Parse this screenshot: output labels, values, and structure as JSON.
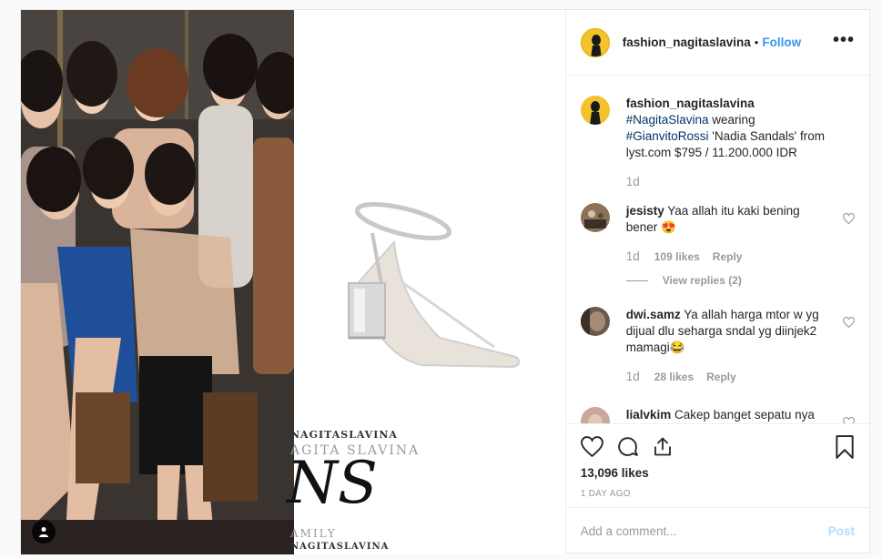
{
  "post": {
    "author": "fashion_nagitaslavina",
    "follow_label": "Follow",
    "separator": "•",
    "more_label": "•••",
    "caption": {
      "username": "fashion_nagitaslavina",
      "hashtag1": "#NagitaSlavina",
      "text1": "wearing",
      "hashtag2": "#GianvitoRossi",
      "text2": "'Nadia Sandals' from lyst.com $795 / 11.200.000 IDR",
      "time": "1d"
    },
    "watermark": {
      "top1": "NAGITASLAVINA",
      "top2": "AGITA SLAVINA",
      "mono": "NS",
      "bottom1": "AMILY",
      "bottom2": "NAGITASLAVINA"
    },
    "comments": [
      {
        "username": "jesisty",
        "text": "Yaa allah itu kaki bening bener 😍",
        "time": "1d",
        "likes": "109 likes",
        "reply": "Reply",
        "view_replies": "View replies (2)"
      },
      {
        "username": "dwi.samz",
        "text": "Ya allah harga mtor w yg dijual dlu seharga sndal yg diinjek2 mamagi😂",
        "time": "1d",
        "likes": "28 likes",
        "reply": "Reply"
      },
      {
        "username": "lialvkim",
        "text": "Cakep banget sepatu nya"
      }
    ],
    "likes_total": "13,096 likes",
    "date": "1 DAY AGO",
    "comment_placeholder": "Add a comment...",
    "post_button": "Post"
  },
  "colors": {
    "link": "#3897f0",
    "hashtag": "#003569",
    "muted": "#999999",
    "post_disabled": "#b2dffc"
  }
}
